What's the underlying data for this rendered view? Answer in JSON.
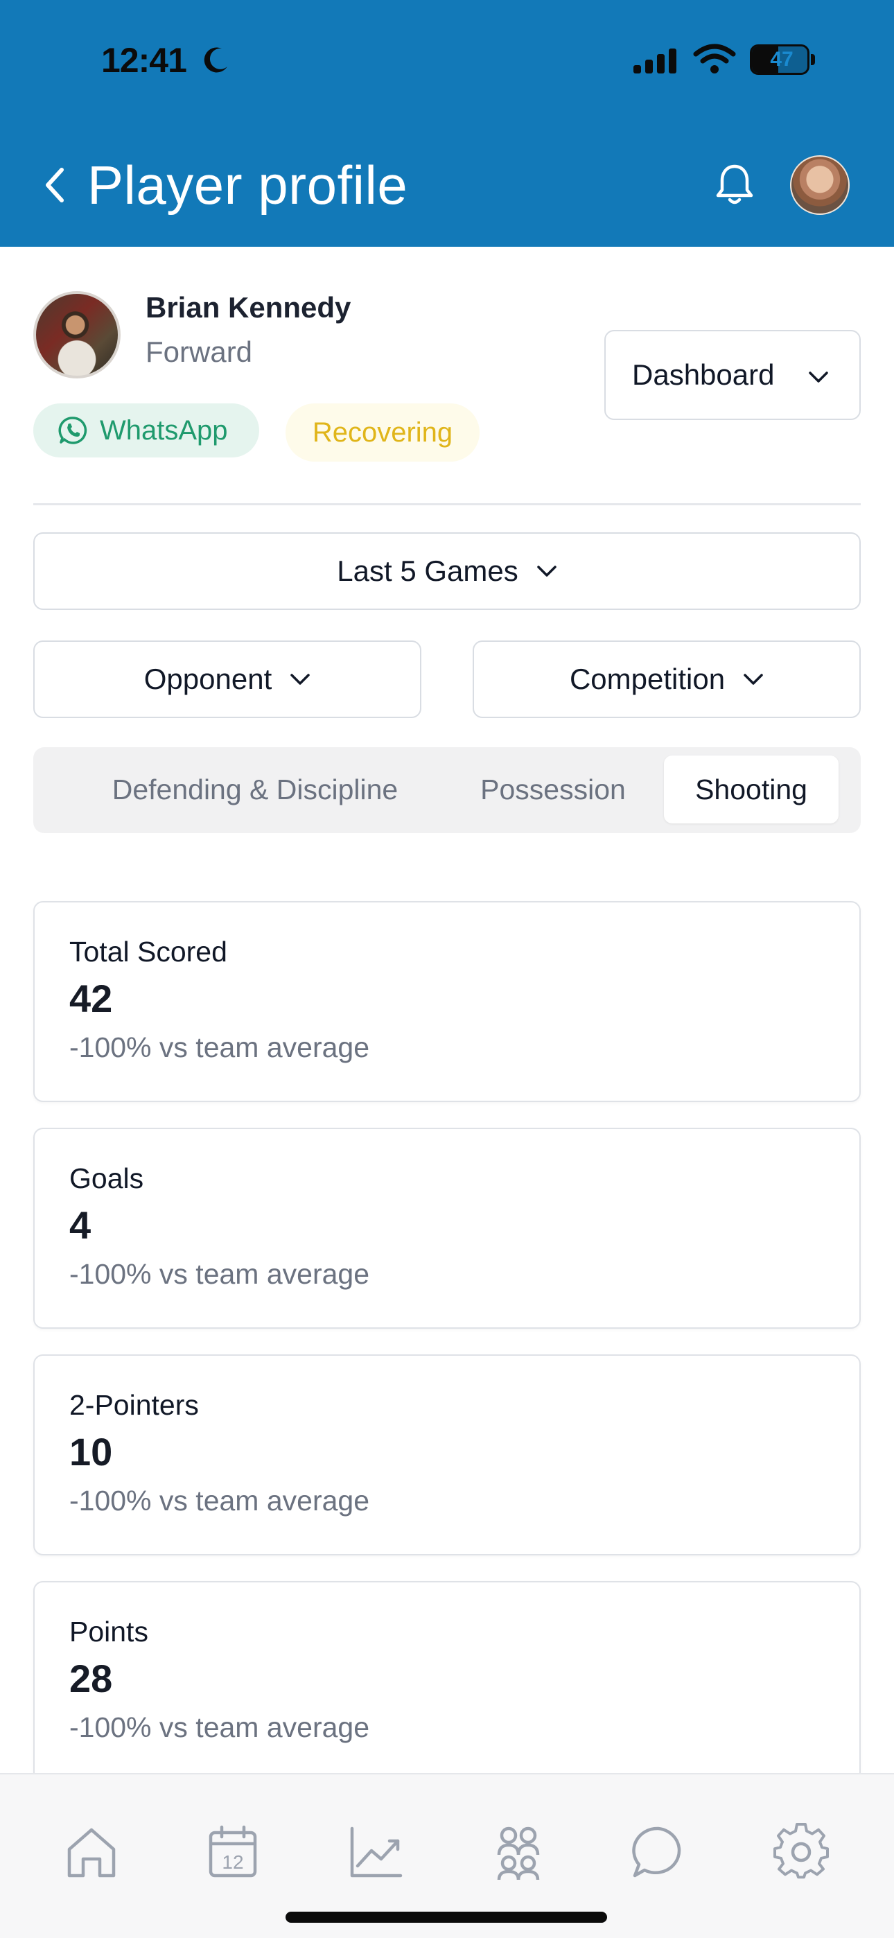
{
  "status_bar": {
    "time": "12:41",
    "battery": "47",
    "battery_level": 0.47
  },
  "header": {
    "title": "Player profile"
  },
  "player": {
    "name": "Brian Kennedy",
    "position": "Forward"
  },
  "view_select": {
    "label": "Dashboard"
  },
  "tags": {
    "whatsapp": "WhatsApp",
    "status": "Recovering"
  },
  "filters": {
    "range": "Last 5 Games",
    "opponent": "Opponent",
    "competition": "Competition"
  },
  "tabs": [
    {
      "label": "Defending & Discipline",
      "active": false
    },
    {
      "label": "Possession",
      "active": false
    },
    {
      "label": "Shooting",
      "active": true
    }
  ],
  "stats": [
    {
      "title": "Total Scored",
      "value": "42",
      "compare": "-100% vs team average"
    },
    {
      "title": "Goals",
      "value": "4",
      "compare": "-100% vs team average"
    },
    {
      "title": "2-Pointers",
      "value": "10",
      "compare": "-100% vs team average"
    },
    {
      "title": "Points",
      "value": "28",
      "compare": "-100% vs team average"
    }
  ],
  "icons": {
    "back": "chevron-left-icon",
    "notifications": "bell-icon",
    "nav": [
      "home-icon",
      "calendar-icon",
      "chart-icon",
      "team-icon",
      "chat-icon",
      "settings-icon"
    ]
  },
  "colors": {
    "header": "#1279b8",
    "whatsapp": "#1f9a6d",
    "recovering": "#e0b51a"
  }
}
